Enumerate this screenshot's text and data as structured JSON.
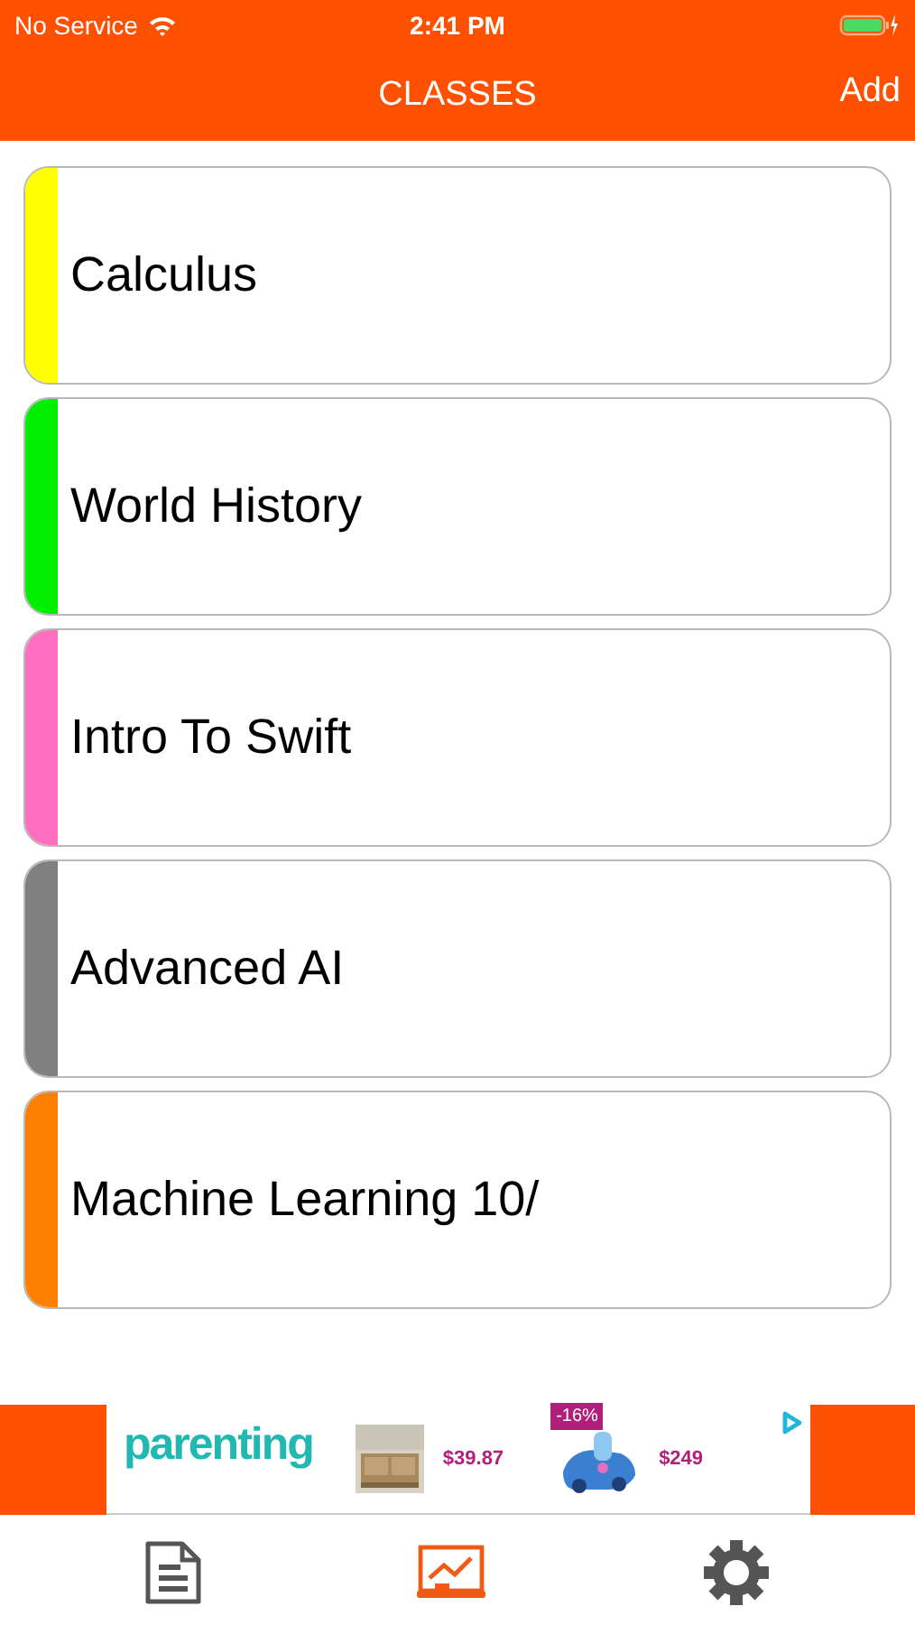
{
  "status_bar": {
    "carrier": "No Service",
    "time": "2:41 PM"
  },
  "nav_bar": {
    "title": "CLASSES",
    "action": "Add"
  },
  "classes": [
    {
      "name": "Calculus",
      "color": "#ffff00"
    },
    {
      "name": "World History",
      "color": "#00ee00"
    },
    {
      "name": "Intro To Swift",
      "color": "#ff6fc0"
    },
    {
      "name": "Advanced AI",
      "color": "#808080"
    },
    {
      "name": "Machine Learning 10/",
      "color": "#ff8000"
    }
  ],
  "ad_banner": {
    "logo": "parenting",
    "products": [
      {
        "kind": "picture",
        "price": "$39.87"
      },
      {
        "kind": "picture",
        "badge": "-16%",
        "price": "$249"
      }
    ]
  },
  "tab_bar": [
    {
      "kind": "document",
      "selected": false
    },
    {
      "kind": "chart",
      "selected": true
    },
    {
      "kind": "settings",
      "selected": false
    }
  ]
}
